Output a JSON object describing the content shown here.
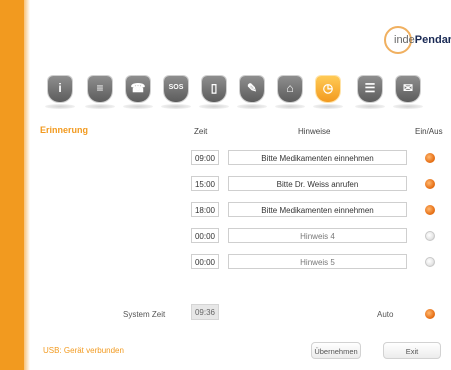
{
  "app": {
    "logo_text_light": "inde",
    "logo_text_bold": "Pendar"
  },
  "toolbar": {
    "icons": [
      {
        "name": "info-icon",
        "glyph": "i",
        "active": false
      },
      {
        "name": "contacts-icon",
        "glyph": "≡",
        "active": false
      },
      {
        "name": "phone-icon",
        "glyph": "☎",
        "active": false
      },
      {
        "name": "sos-icon",
        "glyph": "SOS",
        "active": false
      },
      {
        "name": "book-icon",
        "glyph": "▯",
        "active": false
      },
      {
        "name": "settings-icon",
        "glyph": "✎",
        "active": false
      },
      {
        "name": "home-icon",
        "glyph": "⌂",
        "active": false
      },
      {
        "name": "alarm-clock-icon",
        "glyph": "◷",
        "active": true
      },
      {
        "name": "list-icon",
        "glyph": "☰",
        "active": false
      },
      {
        "name": "message-icon",
        "glyph": "✉",
        "active": false
      }
    ],
    "active_color": "#f29a1f"
  },
  "section_title": "Erinnerung",
  "columns": {
    "time": "Zeit",
    "hints": "Hinweise",
    "on_off": "Ein/Aus"
  },
  "reminders": [
    {
      "time": "09:00",
      "hint": "Bitte Medikamenten einnehmen",
      "enabled": true
    },
    {
      "time": "15:00",
      "hint": "Bitte Dr. Weiss anrufen",
      "enabled": true
    },
    {
      "time": "18:00",
      "hint": "Bitte Medikamenten einnehmen",
      "enabled": true
    },
    {
      "time": "00:00",
      "hint": "Hinweis 4",
      "enabled": false
    },
    {
      "time": "00:00",
      "hint": "Hinweis 5",
      "enabled": false
    }
  ],
  "system_time": {
    "label": "System Zeit",
    "value": "09:36"
  },
  "auto": {
    "label": "Auto",
    "enabled": true
  },
  "status": {
    "usb": "USB: Gerät verbunden"
  },
  "buttons": {
    "apply": "Übernehmen",
    "exit": "Exit"
  },
  "colors": {
    "accent": "#f29a1f",
    "brand_dark": "#1a2a55"
  }
}
